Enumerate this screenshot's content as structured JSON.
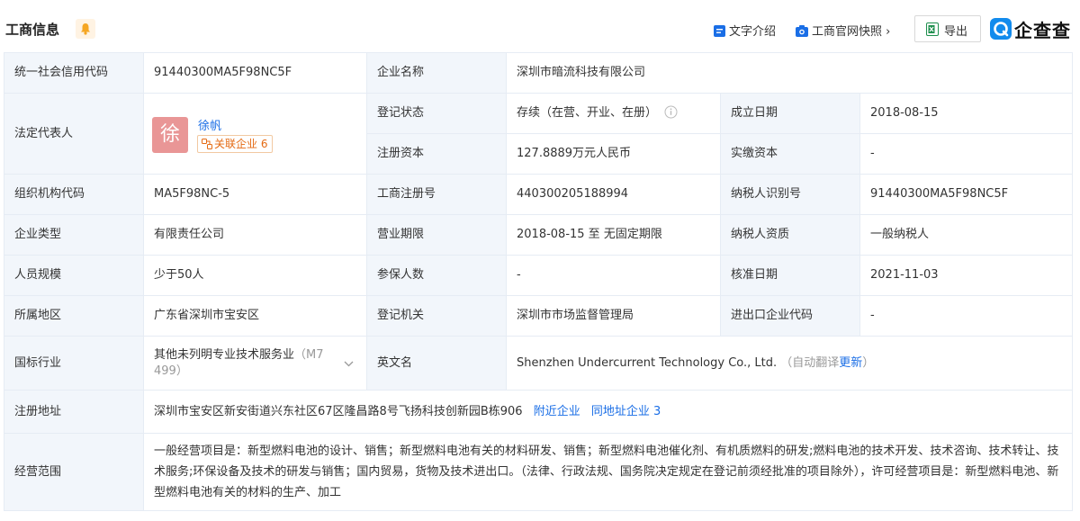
{
  "header": {
    "title": "工商信息",
    "text_intro": "文字介绍",
    "official_snapshot": "工商官网快照",
    "snapshot_chevron": "›",
    "export": "导出",
    "brand_name": "企查查"
  },
  "colors": {
    "accent": "#1a6ee6",
    "label_bg": "#f2f6fb",
    "avatar": "#e99696",
    "badge": "#e46a13"
  },
  "rows": {
    "credit_code_label": "统一社会信用代码",
    "credit_code": "91440300MA5F98NC5F",
    "company_name_label": "企业名称",
    "company_name": "深圳市暗流科技有限公司",
    "legal_rep_label": "法定代表人",
    "legal_rep_avatar": "徐",
    "legal_rep_name": "徐帆",
    "related_label": "关联企业",
    "related_count": "6",
    "reg_status_label": "登记状态",
    "reg_status": "存续（在营、开业、在册）",
    "founded_label": "成立日期",
    "founded": "2018-08-15",
    "reg_capital_label": "注册资本",
    "reg_capital": "127.8889万元人民币",
    "paid_capital_label": "实缴资本",
    "paid_capital": "-",
    "org_code_label": "组织机构代码",
    "org_code": "MA5F98NC-5",
    "biz_reg_no_label": "工商注册号",
    "biz_reg_no": "440300205188994",
    "taxpayer_id_label": "纳税人识别号",
    "taxpayer_id": "91440300MA5F98NC5F",
    "company_type_label": "企业类型",
    "company_type": "有限责任公司",
    "biz_term_label": "营业期限",
    "biz_term": "2018-08-15 至 无固定期限",
    "taxpayer_qual_label": "纳税人资质",
    "taxpayer_qual": "一般纳税人",
    "staff_label": "人员规模",
    "staff": "少于50人",
    "insured_label": "参保人数",
    "insured": "-",
    "approval_date_label": "核准日期",
    "approval_date": "2021-11-03",
    "region_label": "所属地区",
    "region": "广东省深圳市宝安区",
    "authority_label": "登记机关",
    "authority": "深圳市市场监督管理局",
    "import_export_label": "进出口企业代码",
    "import_export": "-",
    "industry_label": "国标行业",
    "industry_line1": "其他未列明专业技术服务业",
    "industry_code_a": "（M7",
    "industry_code_b": "499）",
    "english_name_label": "英文名",
    "english_name": "Shenzhen Undercurrent Technology Co., Ltd.",
    "auto_translate": "（自动翻译",
    "update": "更新",
    "auto_translate_end": "）",
    "address_label": "注册地址",
    "address": "深圳市宝安区新安街道兴东社区67区隆昌路8号飞扬科技创新园B栋906",
    "nearby": "附近企业",
    "same_address": "同地址企业",
    "same_address_count": "3",
    "scope_label": "经营范围",
    "scope": "一般经营项目是：新型燃料电池的设计、销售；新型燃料电池有关的材料研发、销售；新型燃料电池催化剂、有机质燃料的研发;燃料电池的技术开发、技术咨询、技术转让、技术服务;环保设备及技术的研发与销售；国内贸易，货物及技术进出口。（法律、行政法规、国务院决定规定在登记前须经批准的项目除外），许可经营项目是：新型燃料电池、新型燃料电池有关的材料的生产、加工"
  }
}
